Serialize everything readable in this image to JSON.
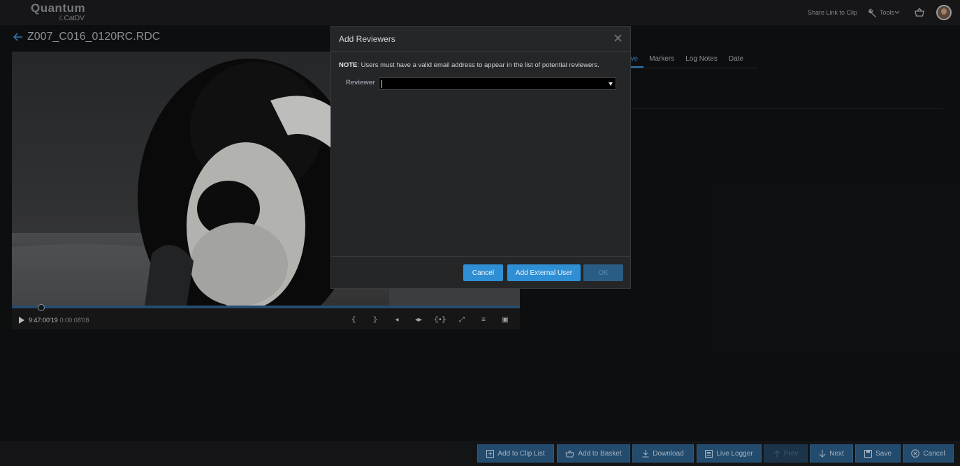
{
  "brand": {
    "name": "Quantum",
    "product": "CatDV"
  },
  "header": {
    "share_link": "Share Link to Clip",
    "tools": "Tools",
    "icons": [
      "wrench-icon",
      "basket-icon",
      "avatar"
    ]
  },
  "clip": {
    "title": "Z007_C016_0120RC.RDC",
    "timecode": "9:47:00'19",
    "duration": "0:00:08'08",
    "playhead_fraction": 0.058
  },
  "tabs": [
    {
      "label": "ove",
      "active": true
    },
    {
      "label": "Markers",
      "active": false
    },
    {
      "label": "Log Notes",
      "active": false
    },
    {
      "label": "Date",
      "active": false
    }
  ],
  "dialog": {
    "title": "Add Reviewers",
    "note_bold": "NOTE",
    "note_text": ": Users must have a valid email address to appear in the list of potential reviewers.",
    "reviewer_label": "Reviewer",
    "reviewer_value": "",
    "buttons": {
      "cancel": "Cancel",
      "add_external": "Add External User",
      "ok": "OK"
    }
  },
  "toolbar": {
    "add_to_clip_list": "Add to Clip List",
    "add_to_basket": "Add to Basket",
    "download": "Download",
    "live_logger": "Live Logger",
    "prev": "Prev",
    "next": "Next",
    "save": "Save",
    "cancel": "Cancel"
  },
  "colors": {
    "accent": "#2f8fd4",
    "toolbar_button": "#2b5c86",
    "background": "#111214"
  }
}
